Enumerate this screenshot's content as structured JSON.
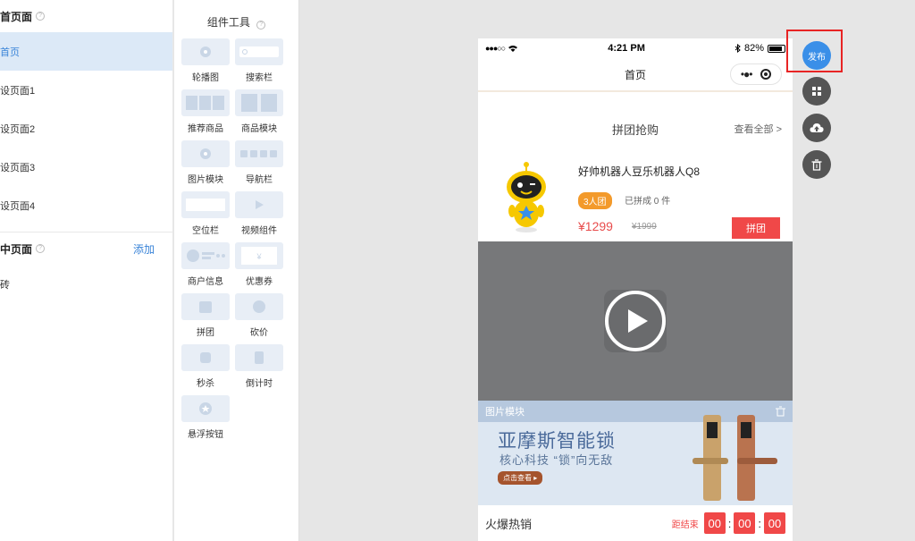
{
  "pages_panel": {
    "section1_title": "首页面",
    "items": [
      {
        "label": "首页",
        "active": true
      },
      {
        "label": "设页面1"
      },
      {
        "label": "设页面2"
      },
      {
        "label": "设页面3"
      },
      {
        "label": "设页面4"
      }
    ],
    "section2_title": "中页面",
    "add_label": "添加",
    "section2_item": "砖"
  },
  "tools": {
    "title": "组件工具",
    "items": [
      {
        "label": "轮播图",
        "icon": "carousel-icon"
      },
      {
        "label": "搜索栏",
        "icon": "search-bar-icon"
      },
      {
        "label": "推荐商品",
        "icon": "recommend-icon"
      },
      {
        "label": "商品模块",
        "icon": "goods-module-icon"
      },
      {
        "label": "图片模块",
        "icon": "image-module-icon"
      },
      {
        "label": "导航栏",
        "icon": "nav-bar-icon"
      },
      {
        "label": "空位栏",
        "icon": "blank-icon"
      },
      {
        "label": "视频组件",
        "icon": "video-icon"
      },
      {
        "label": "商户信息",
        "icon": "merchant-icon"
      },
      {
        "label": "优惠券",
        "icon": "coupon-icon"
      },
      {
        "label": "拼团",
        "icon": "group-buy-icon"
      },
      {
        "label": "砍价",
        "icon": "bargain-icon"
      },
      {
        "label": "秒杀",
        "icon": "flash-sale-icon"
      },
      {
        "label": "倒计时",
        "icon": "countdown-icon"
      },
      {
        "label": "悬浮按钮",
        "icon": "float-button-icon"
      }
    ]
  },
  "phone": {
    "status_time": "4:21 PM",
    "status_battery": "82%",
    "nav_title": "首页",
    "group_title": "拼团抢购",
    "see_all": "查看全部 >",
    "product": {
      "name": "好帅机器人豆乐机器人Q8",
      "tag": "3人团",
      "sold": "已拼成 0 件",
      "price": "¥1299",
      "original_price": "¥1999",
      "button": "拼团"
    },
    "banner": {
      "bar_label": "图片模块",
      "title": "亚摩斯智能锁",
      "subtitle": "核心科技 “锁”向无敌",
      "button": "点击查看 ▸"
    },
    "hot": {
      "title": "火爆热销",
      "countdown_label": "距结束",
      "hours": "00",
      "minutes": "00",
      "seconds": "00"
    }
  },
  "actions": {
    "publish": "发布"
  },
  "colors": {
    "accent": "#3a8fe8",
    "price_red": "#f04848",
    "tag_orange": "#f39a2b",
    "highlight_frame": "#e82424"
  }
}
